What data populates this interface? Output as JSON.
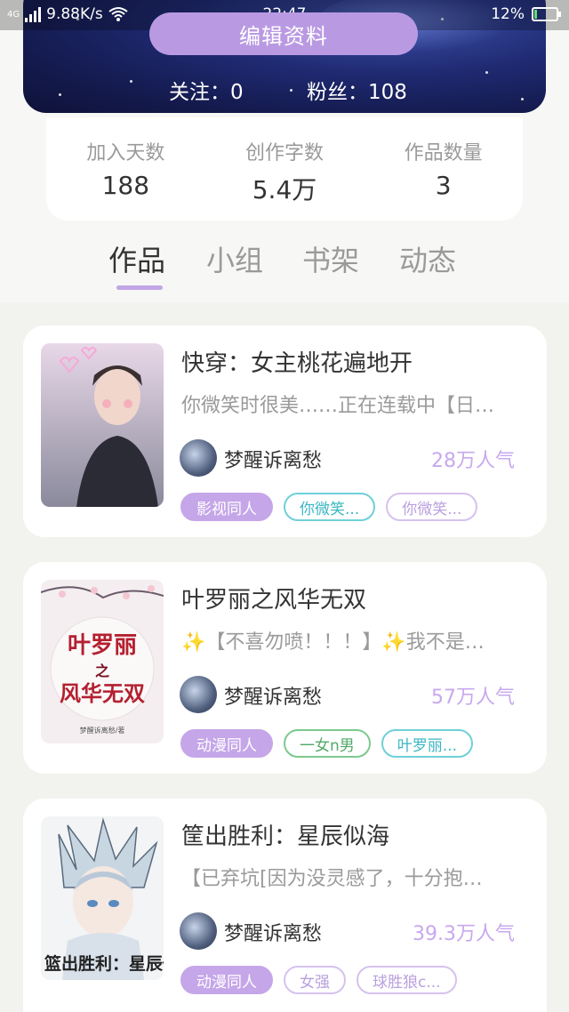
{
  "status_bar": {
    "network": "4G",
    "speed": "9.88K/s",
    "time": "22:47",
    "battery_percent": "12%",
    "battery_level": 0.12
  },
  "profile": {
    "edit_label": "编辑资料",
    "following_label": "关注：0",
    "followers_label": "粉丝：108"
  },
  "stats": [
    {
      "label": "加入天数",
      "value": "188"
    },
    {
      "label": "创作字数",
      "value": "5.4万"
    },
    {
      "label": "作品数量",
      "value": "3"
    }
  ],
  "tabs": [
    "作品",
    "小组",
    "书架",
    "动态"
  ],
  "works": [
    {
      "title": "快穿：女主桃花遍地开",
      "desc": "你微笑时很美……正在连载中【日…",
      "author": "梦醒诉离愁",
      "popularity": "28万人气",
      "tags": [
        {
          "text": "影视同人",
          "style": "fill"
        },
        {
          "text": "你微笑...",
          "style": "teal"
        },
        {
          "text": "你微笑...",
          "style": "lav"
        }
      ]
    },
    {
      "title": "叶罗丽之风华无双",
      "desc": "✨【不喜勿喷！！！】✨我不是…",
      "author": "梦醒诉离愁",
      "popularity": "57万人气",
      "tags": [
        {
          "text": "动漫同人",
          "style": "fill"
        },
        {
          "text": "一女n男",
          "style": "green"
        },
        {
          "text": "叶罗丽...",
          "style": "teal"
        }
      ]
    },
    {
      "title": "筐出胜利：星辰似海",
      "desc": "【已弃坑[因为没灵感了，十分抱…",
      "author": "梦醒诉离愁",
      "popularity": "39.3万人气",
      "tags": [
        {
          "text": "动漫同人",
          "style": "fill"
        },
        {
          "text": "女强",
          "style": "lav"
        },
        {
          "text": "球胜狼c...",
          "style": "lav"
        }
      ]
    }
  ]
}
